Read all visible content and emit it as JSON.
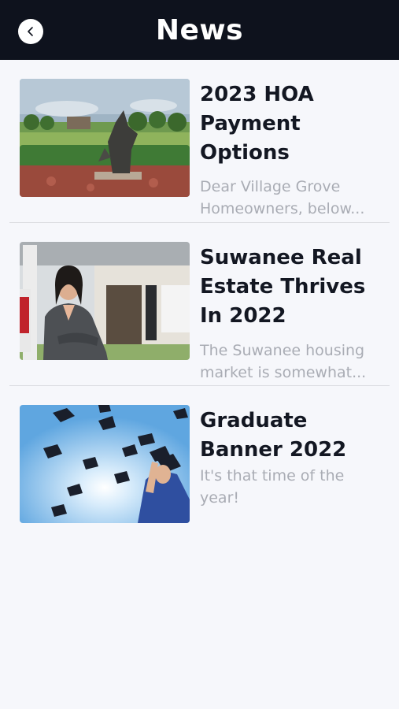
{
  "header": {
    "title": "News",
    "back_icon": "chevron-left-icon",
    "bar_color": "#0e121d"
  },
  "articles": [
    {
      "headline": "2023 HOA Payment Options",
      "excerpt_line1": "Dear Village Grove",
      "excerpt_line2": "Homeowners, below..."
    },
    {
      "headline": "Suwanee Real Estate Thrives In 2022",
      "excerpt_line1": "The Suwanee housing",
      "excerpt_line2": "market is somewhat..."
    },
    {
      "headline": "Graduate Banner 2022",
      "excerpt_line1": "It's that time of the",
      "excerpt_line2": "year!"
    }
  ]
}
